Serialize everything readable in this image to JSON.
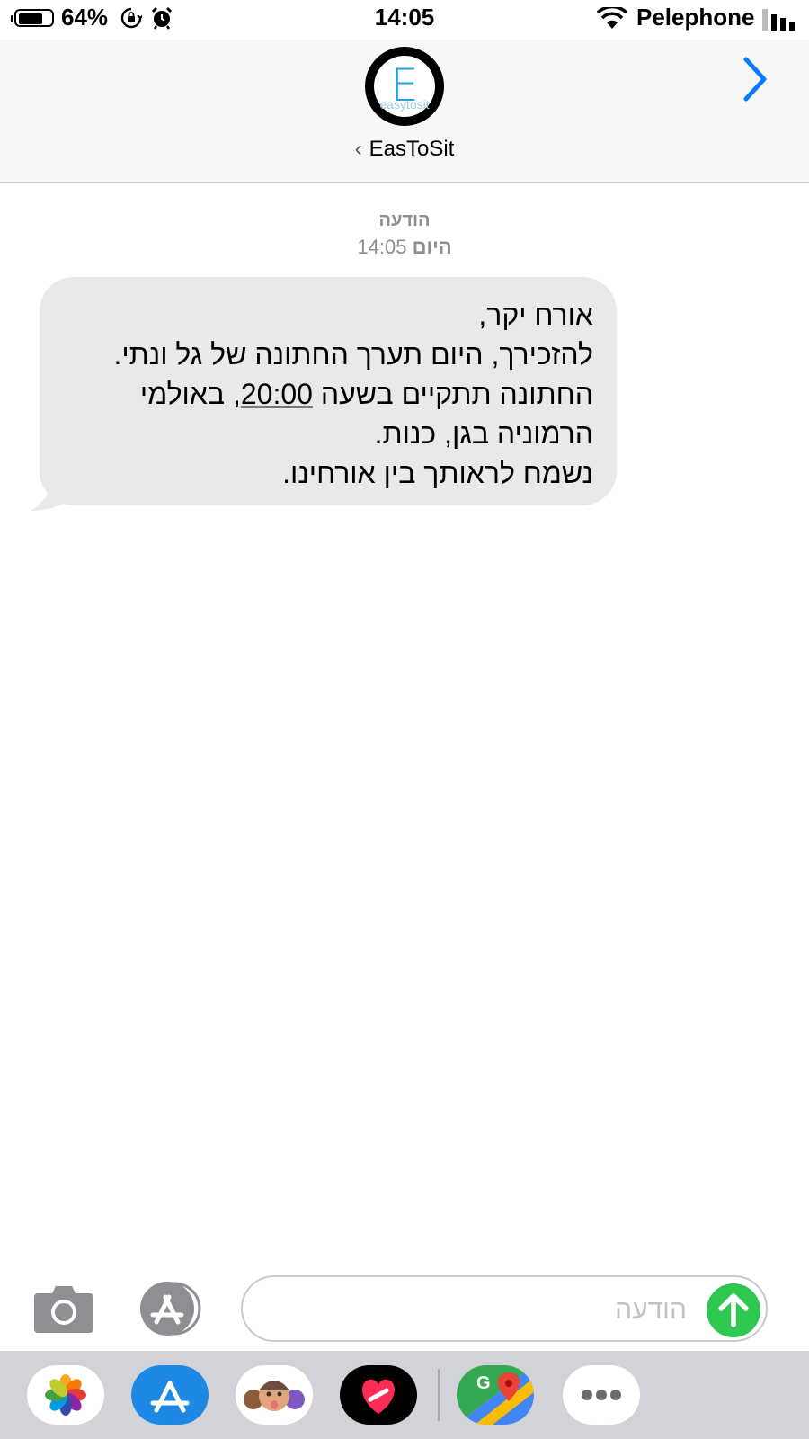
{
  "status_bar": {
    "battery_percent": "64%",
    "battery_level": 0.64,
    "time": "14:05",
    "carrier": "Pelephone",
    "icons": [
      "battery-icon",
      "rotation-lock-icon",
      "alarm-icon",
      "wifi-icon",
      "cellular-signal-icon"
    ]
  },
  "header": {
    "contact_name": "EasToSit",
    "avatar_logo_letter": "E",
    "avatar_logo_text": "easytosit",
    "icons": [
      "back-chevron-icon",
      "forward-chevron-icon"
    ]
  },
  "conversation": {
    "meta_label": "הודעה",
    "meta_day": "היום",
    "meta_time": "14:05",
    "messages": [
      {
        "line1": "אורח יקר,",
        "line2": "להזכירך, היום תערך החתונה של גל ונתי.",
        "line3_before": "החתונה תתקיים בשעה ",
        "line3_time": "20:00",
        "line3_after": ", באולמי",
        "line4": "הרמוניה בגן, כנות.",
        "line5": "נשמח לראותך בין אורחינו."
      }
    ]
  },
  "composer": {
    "placeholder": "הודעה",
    "icons": [
      "camera-icon",
      "app-store-icon",
      "send-arrow-icon"
    ]
  },
  "app_drawer": {
    "apps": [
      "photos-icon",
      "app-store-icon",
      "memoji-icon",
      "digital-touch-icon",
      "google-maps-icon",
      "more-icon"
    ]
  },
  "colors": {
    "accent_blue": "#0a7aff",
    "send_green": "#2ec74f",
    "bubble_gray": "#e9e9eb",
    "meta_gray": "#8e8e93"
  }
}
